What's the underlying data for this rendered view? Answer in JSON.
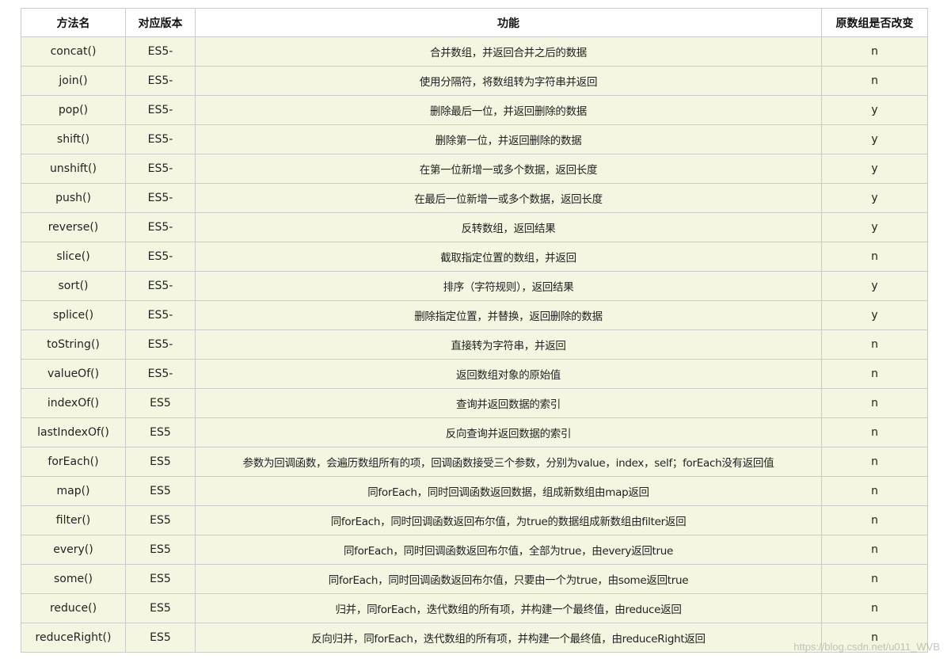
{
  "table": {
    "headers": [
      "方法名",
      "对应版本",
      "功能",
      "原数组是否改变"
    ],
    "rows": [
      [
        "concat()",
        "ES5-",
        "合并数组，并返回合并之后的数据",
        "n"
      ],
      [
        "join()",
        "ES5-",
        "使用分隔符，将数组转为字符串并返回",
        "n"
      ],
      [
        "pop()",
        "ES5-",
        "删除最后一位，并返回删除的数据",
        "y"
      ],
      [
        "shift()",
        "ES5-",
        "删除第一位，并返回删除的数据",
        "y"
      ],
      [
        "unshift()",
        "ES5-",
        "在第一位新增一或多个数据，返回长度",
        "y"
      ],
      [
        "push()",
        "ES5-",
        "在最后一位新增一或多个数据，返回长度",
        "y"
      ],
      [
        "reverse()",
        "ES5-",
        "反转数组，返回结果",
        "y"
      ],
      [
        "slice()",
        "ES5-",
        "截取指定位置的数组，并返回",
        "n"
      ],
      [
        "sort()",
        "ES5-",
        "排序（字符规则），返回结果",
        "y"
      ],
      [
        "splice()",
        "ES5-",
        "删除指定位置，并替换，返回删除的数据",
        "y"
      ],
      [
        "toString()",
        "ES5-",
        "直接转为字符串，并返回",
        "n"
      ],
      [
        "valueOf()",
        "ES5-",
        "返回数组对象的原始值",
        "n"
      ],
      [
        "indexOf()",
        "ES5",
        "查询并返回数据的索引",
        "n"
      ],
      [
        "lastIndexOf()",
        "ES5",
        "反向查询并返回数据的索引",
        "n"
      ],
      [
        "forEach()",
        "ES5",
        "参数为回调函数，会遍历数组所有的项，回调函数接受三个参数，分别为value，index，self；forEach没有返回值",
        "n"
      ],
      [
        "map()",
        "ES5",
        "同forEach，同时回调函数返回数据，组成新数组由map返回",
        "n"
      ],
      [
        "filter()",
        "ES5",
        "同forEach，同时回调函数返回布尔值，为true的数据组成新数组由filter返回",
        "n"
      ],
      [
        "every()",
        "ES5",
        "同forEach，同时回调函数返回布尔值，全部为true，由every返回true",
        "n"
      ],
      [
        "some()",
        "ES5",
        "同forEach，同时回调函数返回布尔值，只要由一个为true，由some返回true",
        "n"
      ],
      [
        "reduce()",
        "ES5",
        "归并，同forEach，迭代数组的所有项，并构建一个最终值，由reduce返回",
        "n"
      ],
      [
        "reduceRight()",
        "ES5",
        "反向归并，同forEach，迭代数组的所有项，并构建一个最终值，由reduceRight返回",
        "n"
      ]
    ]
  },
  "watermark": "https://blog.csdn.net/u011_WVB"
}
